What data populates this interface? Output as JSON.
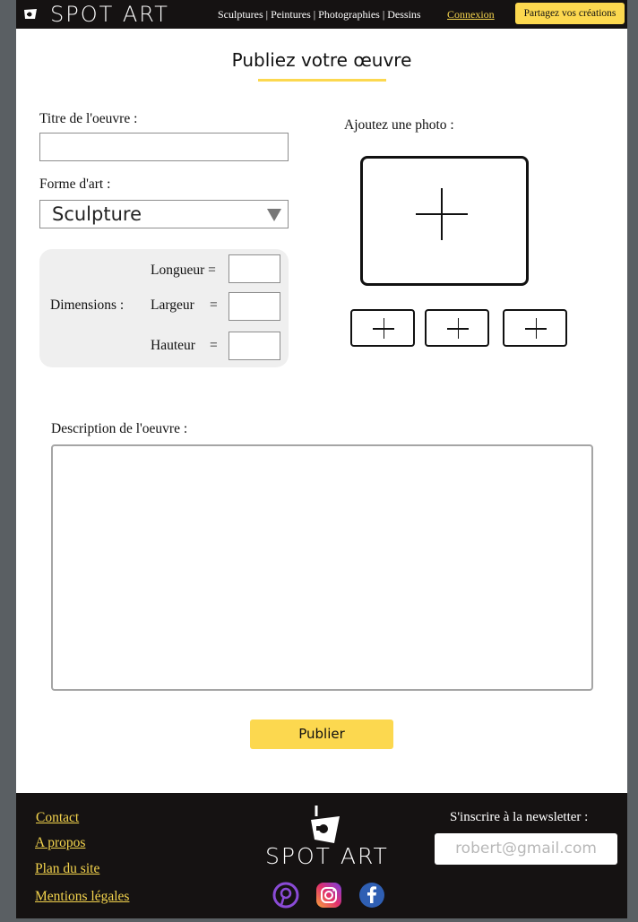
{
  "header": {
    "brand": "SPOT ART",
    "nav": [
      "Sculptures",
      "Peintures",
      "Photographies",
      "Dessins"
    ],
    "nav_sep": "|",
    "login": "Connexion",
    "share": "Partagez vos créations"
  },
  "page_title": "Publiez votre œuvre",
  "form": {
    "title_label": "Titre de l'oeuvre :",
    "title_value": "",
    "art_form_label": "Forme d'art :",
    "art_form_value": "Sculpture",
    "dimensions_label": "Dimensions :",
    "length_label": "Longueur =",
    "width_label": "Largeur",
    "height_label": "Hauteur",
    "equals": "=",
    "photo_label": "Ajoutez une photo :",
    "description_label": "Description de l'oeuvre :",
    "publish": "Publier"
  },
  "footer": {
    "links": [
      "Contact",
      "A propos",
      "Plan du site",
      "Mentions légales"
    ],
    "brand": "SPOT ART",
    "newsletter_label": "S'inscrire à la newsletter :",
    "newsletter_placeholder": "robert@gmail.com",
    "social": [
      "pinterest-icon",
      "instagram-icon",
      "facebook-icon"
    ]
  },
  "colors": {
    "accent": "#fcd84f",
    "dark": "#151212",
    "link": "#f4d44d"
  }
}
